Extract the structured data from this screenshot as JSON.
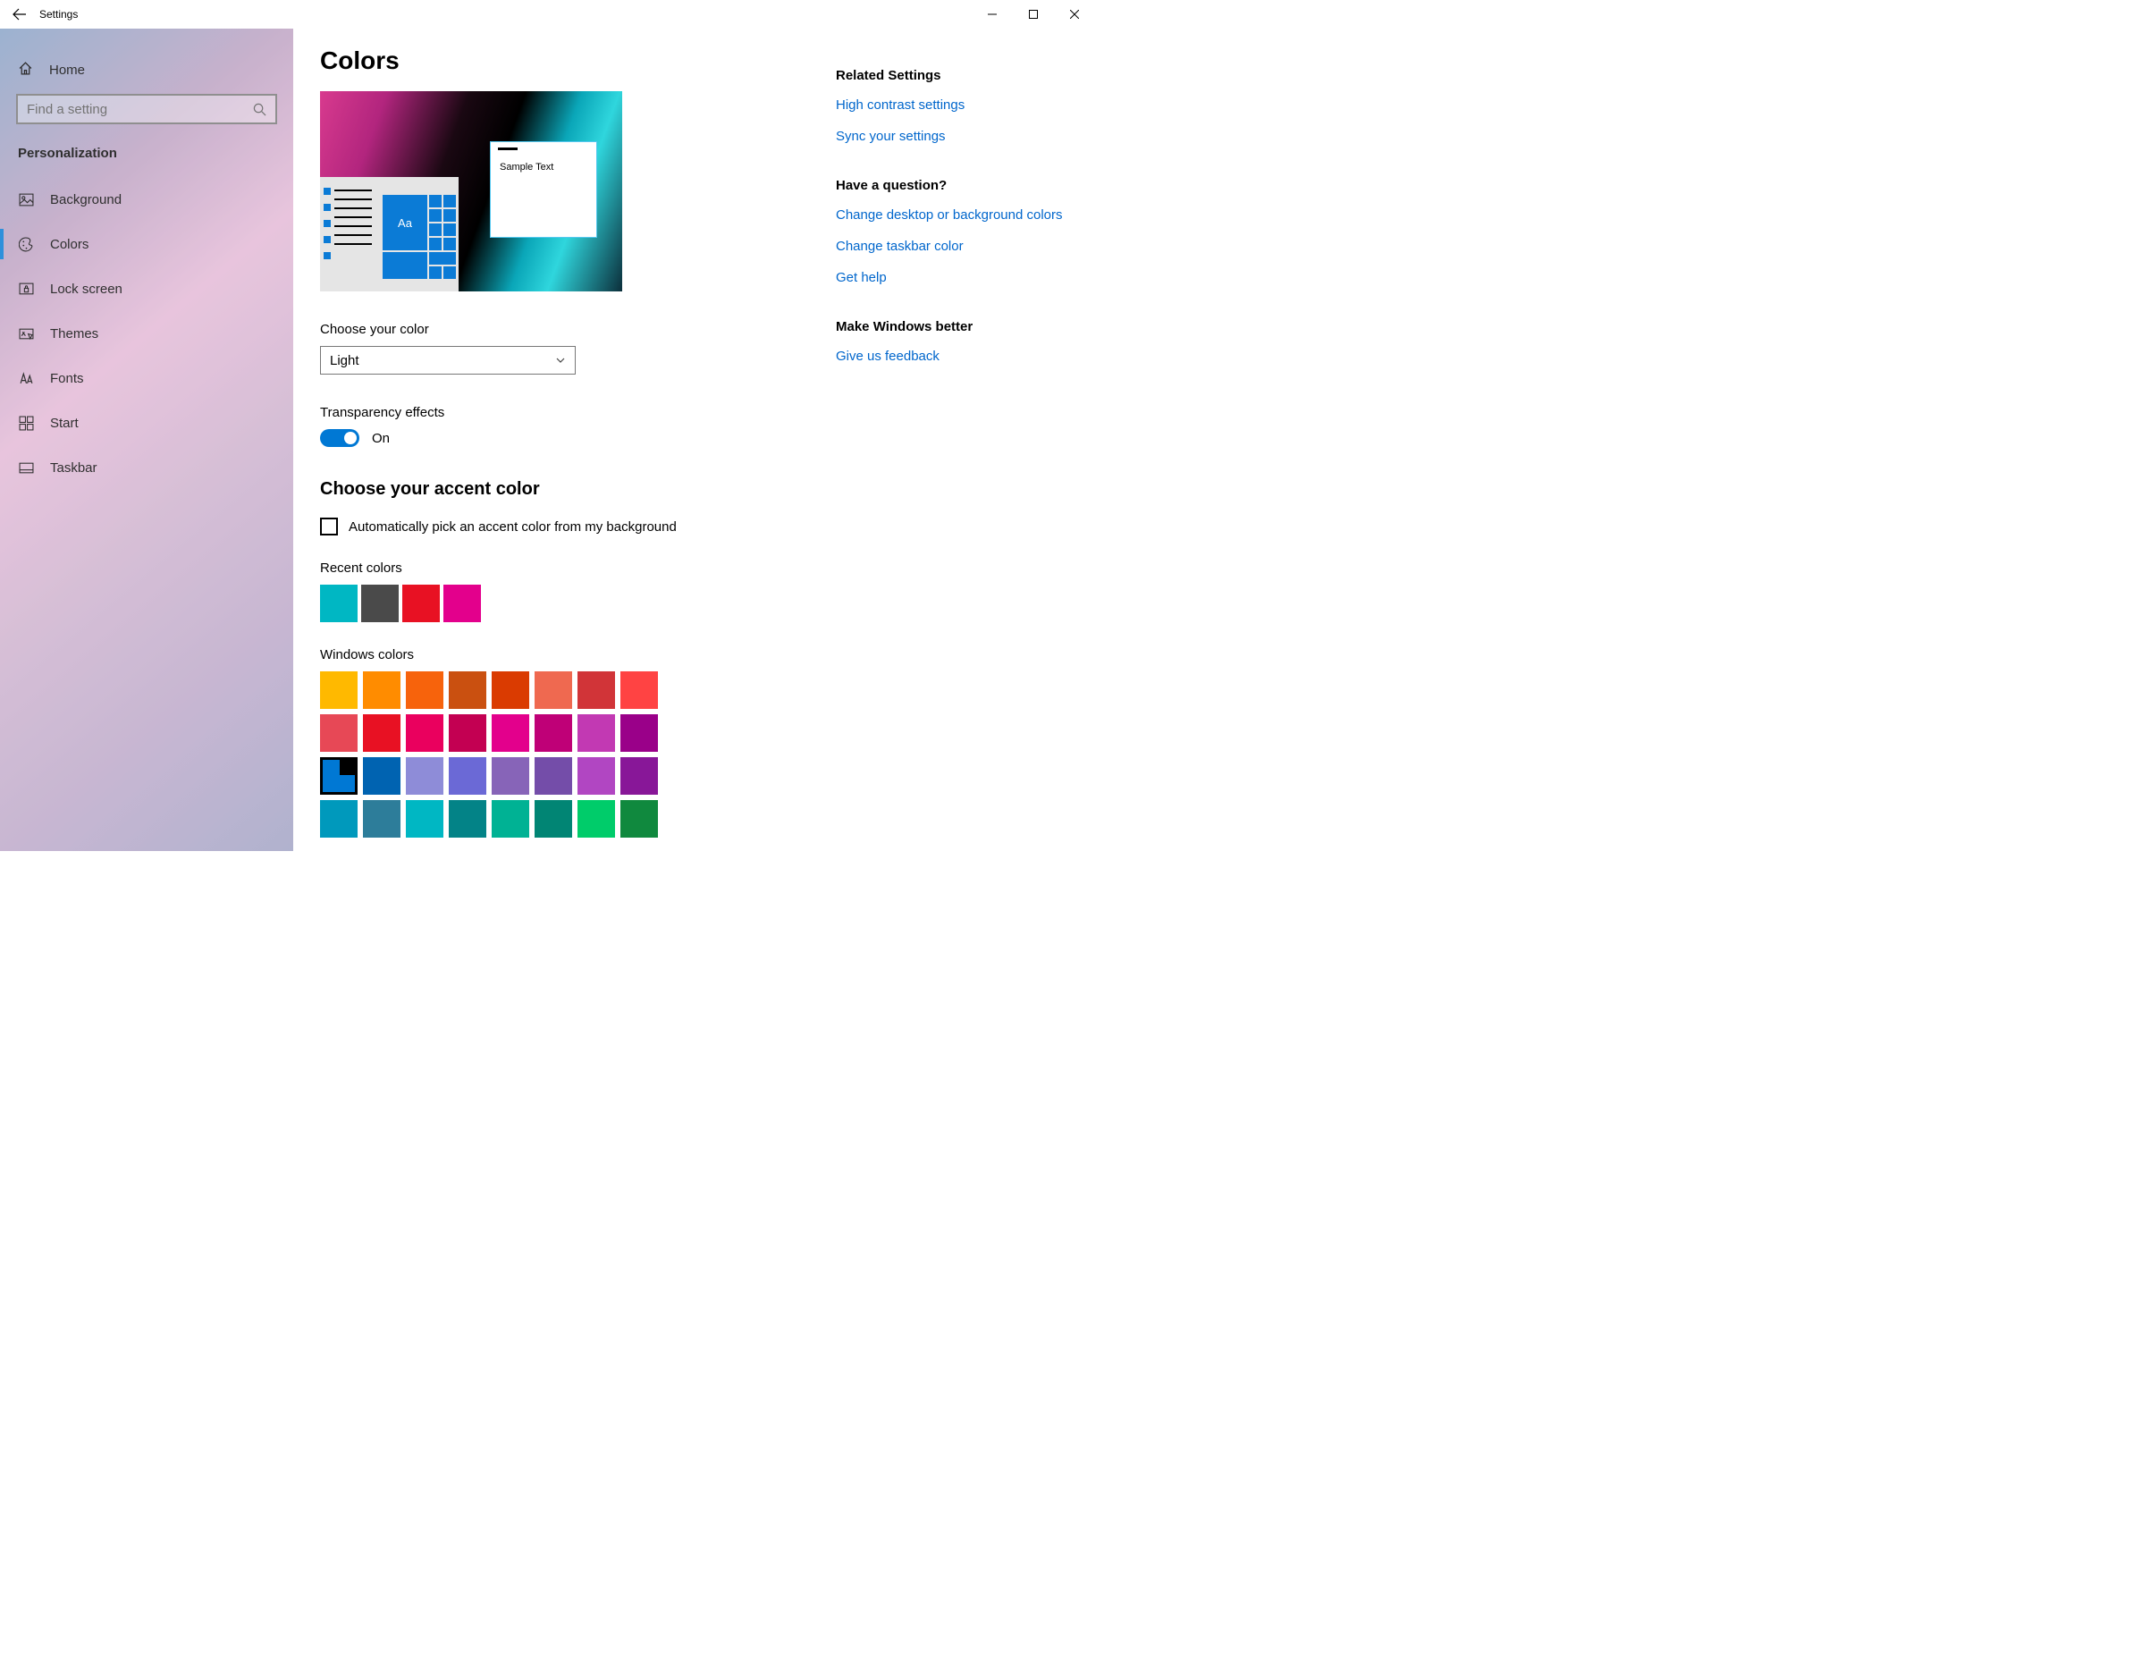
{
  "titlebar": {
    "title": "Settings"
  },
  "sidebar": {
    "home_label": "Home",
    "search_placeholder": "Find a setting",
    "category": "Personalization",
    "items": [
      {
        "label": "Background",
        "icon": "image-icon",
        "selected": false
      },
      {
        "label": "Colors",
        "icon": "palette-icon",
        "selected": true
      },
      {
        "label": "Lock screen",
        "icon": "lock-screen-icon",
        "selected": false
      },
      {
        "label": "Themes",
        "icon": "themes-icon",
        "selected": false
      },
      {
        "label": "Fonts",
        "icon": "fonts-icon",
        "selected": false
      },
      {
        "label": "Start",
        "icon": "start-icon",
        "selected": false
      },
      {
        "label": "Taskbar",
        "icon": "taskbar-icon",
        "selected": false
      }
    ]
  },
  "page": {
    "title": "Colors",
    "preview": {
      "sample_text": "Sample Text",
      "tile_text": "Aa"
    },
    "choose_color": {
      "label": "Choose your color",
      "value": "Light"
    },
    "transparency": {
      "label": "Transparency effects",
      "state_label": "On",
      "on": true
    },
    "accent_heading": "Choose your accent color",
    "auto_pick": {
      "label": "Automatically pick an accent color from my background",
      "checked": false
    },
    "recent": {
      "label": "Recent colors",
      "colors": [
        "#00b7c3",
        "#4a4a4a",
        "#e81123",
        "#e3008c"
      ]
    },
    "windows_colors": {
      "label": "Windows colors",
      "selected_index": 16,
      "colors": [
        "#ffb900",
        "#ff8c00",
        "#f7630c",
        "#ca5010",
        "#da3b01",
        "#ef6950",
        "#d13438",
        "#ff4343",
        "#e74856",
        "#e81123",
        "#ea005e",
        "#c30052",
        "#e3008c",
        "#bf0077",
        "#c239b3",
        "#9a0089",
        "#0078d4",
        "#0063b1",
        "#8e8cd8",
        "#6b69d6",
        "#8764b8",
        "#744da9",
        "#b146c2",
        "#881798",
        "#0099bc",
        "#2d7d9a",
        "#00b7c3",
        "#038387",
        "#00b294",
        "#018574",
        "#00cc6a",
        "#10893e"
      ]
    }
  },
  "aside": {
    "related_heading": "Related Settings",
    "related_links": [
      "High contrast settings",
      "Sync your settings"
    ],
    "question_heading": "Have a question?",
    "question_links": [
      "Change desktop or background colors",
      "Change taskbar color",
      "Get help"
    ],
    "better_heading": "Make Windows better",
    "better_links": [
      "Give us feedback"
    ]
  }
}
